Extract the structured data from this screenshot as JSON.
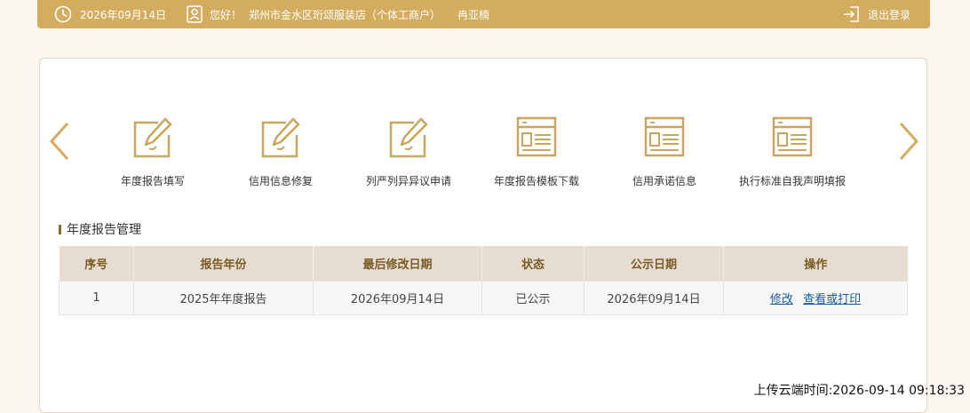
{
  "header": {
    "date": "2026年09月14日",
    "greeting": "您好！",
    "company": "郑州市金水区珩颂服装店（个体工商户）",
    "user": "冉亚楠",
    "logout_label": "退出登录"
  },
  "carousel": {
    "items": [
      {
        "label": "年度报告填写",
        "icon": "edit-icon"
      },
      {
        "label": "信用信息修复",
        "icon": "edit-icon"
      },
      {
        "label": "列严列异异议申请",
        "icon": "edit-icon"
      },
      {
        "label": "年度报告模板下载",
        "icon": "template-icon"
      },
      {
        "label": "信用承诺信息",
        "icon": "template-icon"
      },
      {
        "label": "执行标准自我声明填报",
        "icon": "template-icon"
      }
    ]
  },
  "section": {
    "title": "年度报告管理"
  },
  "table": {
    "headers": [
      "序号",
      "报告年份",
      "最后修改日期",
      "状态",
      "公示日期",
      "操作"
    ],
    "rows": [
      {
        "index": "1",
        "year": "2025年年度报告",
        "modified": "2026年09月14日",
        "status": "已公示",
        "publish_date": "2026年09月14日",
        "action_edit": "修改",
        "action_view": "查看或打印"
      }
    ]
  },
  "footer": {
    "upload_time": "上传云端时间:2026-09-14 09:18:33"
  },
  "colors": {
    "accent": "#d3ac5d",
    "header_bg": "#e6ddd0",
    "link": "#1a5a9c"
  }
}
